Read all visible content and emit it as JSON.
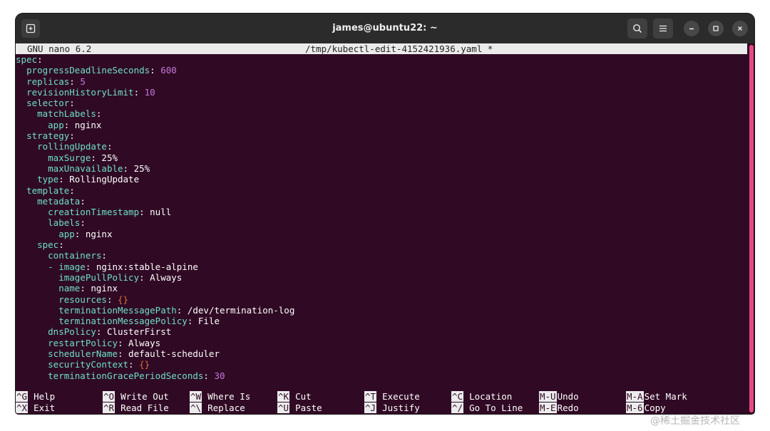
{
  "window": {
    "title": "james@ubuntu22: ~"
  },
  "nano": {
    "app": "GNU nano 6.2",
    "file": "/tmp/kubectl-edit-4152421936.yaml *"
  },
  "lines": [
    [
      [
        "k",
        "spec"
      ],
      [
        "s",
        ":"
      ]
    ],
    [
      [
        "s",
        "  "
      ],
      [
        "k",
        "progressDeadlineSeconds"
      ],
      [
        "s",
        ": "
      ],
      [
        "n",
        "600"
      ]
    ],
    [
      [
        "s",
        "  "
      ],
      [
        "k",
        "replicas"
      ],
      [
        "s",
        ": "
      ],
      [
        "n",
        "5"
      ]
    ],
    [
      [
        "s",
        "  "
      ],
      [
        "k",
        "revisionHistoryLimit"
      ],
      [
        "s",
        ": "
      ],
      [
        "n",
        "10"
      ]
    ],
    [
      [
        "s",
        "  "
      ],
      [
        "k",
        "selector"
      ],
      [
        "s",
        ":"
      ]
    ],
    [
      [
        "s",
        "    "
      ],
      [
        "k",
        "matchLabels"
      ],
      [
        "s",
        ":"
      ]
    ],
    [
      [
        "s",
        "      "
      ],
      [
        "k",
        "app"
      ],
      [
        "s",
        ": nginx"
      ]
    ],
    [
      [
        "s",
        "  "
      ],
      [
        "k",
        "strategy"
      ],
      [
        "s",
        ":"
      ]
    ],
    [
      [
        "s",
        "    "
      ],
      [
        "k",
        "rollingUpdate"
      ],
      [
        "s",
        ":"
      ]
    ],
    [
      [
        "s",
        "      "
      ],
      [
        "k",
        "maxSurge"
      ],
      [
        "s",
        ": 25%"
      ]
    ],
    [
      [
        "s",
        "      "
      ],
      [
        "k",
        "maxUnavailable"
      ],
      [
        "s",
        ": 25%"
      ]
    ],
    [
      [
        "s",
        "    "
      ],
      [
        "k",
        "type"
      ],
      [
        "s",
        ": RollingUpdate"
      ]
    ],
    [
      [
        "s",
        "  "
      ],
      [
        "k",
        "template"
      ],
      [
        "s",
        ":"
      ]
    ],
    [
      [
        "s",
        "    "
      ],
      [
        "k",
        "metadata"
      ],
      [
        "s",
        ":"
      ]
    ],
    [
      [
        "s",
        "      "
      ],
      [
        "k",
        "creationTimestamp"
      ],
      [
        "s",
        ": null"
      ]
    ],
    [
      [
        "s",
        "      "
      ],
      [
        "k",
        "labels"
      ],
      [
        "s",
        ":"
      ]
    ],
    [
      [
        "s",
        "        "
      ],
      [
        "k",
        "app"
      ],
      [
        "s",
        ": nginx"
      ]
    ],
    [
      [
        "s",
        "    "
      ],
      [
        "k",
        "spec"
      ],
      [
        "s",
        ":"
      ]
    ],
    [
      [
        "s",
        "      "
      ],
      [
        "k",
        "containers"
      ],
      [
        "s",
        ":"
      ]
    ],
    [
      [
        "s",
        "      "
      ],
      [
        "k",
        "- image"
      ],
      [
        "s",
        ": nginx:stable-alpine"
      ]
    ],
    [
      [
        "s",
        "        "
      ],
      [
        "k",
        "imagePullPolicy"
      ],
      [
        "s",
        ": Always"
      ]
    ],
    [
      [
        "s",
        "        "
      ],
      [
        "k",
        "name"
      ],
      [
        "s",
        ": nginx"
      ]
    ],
    [
      [
        "s",
        "        "
      ],
      [
        "k",
        "resources"
      ],
      [
        "s",
        ": "
      ],
      [
        "b",
        "{}"
      ]
    ],
    [
      [
        "s",
        "        "
      ],
      [
        "k",
        "terminationMessagePath"
      ],
      [
        "s",
        ": /dev/termination-log"
      ]
    ],
    [
      [
        "s",
        "        "
      ],
      [
        "k",
        "terminationMessagePolicy"
      ],
      [
        "s",
        ": File"
      ]
    ],
    [
      [
        "s",
        "      "
      ],
      [
        "k",
        "dnsPolicy"
      ],
      [
        "s",
        ": ClusterFirst"
      ]
    ],
    [
      [
        "s",
        "      "
      ],
      [
        "k",
        "restartPolicy"
      ],
      [
        "s",
        ": Always"
      ]
    ],
    [
      [
        "s",
        "      "
      ],
      [
        "k",
        "schedulerName"
      ],
      [
        "s",
        ": default-scheduler"
      ]
    ],
    [
      [
        "s",
        "      "
      ],
      [
        "k",
        "securityContext"
      ],
      [
        "s",
        ": "
      ],
      [
        "b",
        "{}"
      ]
    ],
    [
      [
        "s",
        "      "
      ],
      [
        "k",
        "terminationGracePeriodSeconds"
      ],
      [
        "s",
        ": "
      ],
      [
        "n",
        "30"
      ]
    ]
  ],
  "shortcuts": [
    {
      "key": "^G",
      "label": "Help"
    },
    {
      "key": "^O",
      "label": "Write Out"
    },
    {
      "key": "^W",
      "label": "Where Is"
    },
    {
      "key": "^K",
      "label": "Cut"
    },
    {
      "key": "^T",
      "label": "Execute"
    },
    {
      "key": "^C",
      "label": "Location"
    },
    {
      "key": "M-U",
      "label": "Undo"
    },
    {
      "key": "M-A",
      "label": "Set Mark"
    },
    {
      "key": "^X",
      "label": "Exit"
    },
    {
      "key": "^R",
      "label": "Read File"
    },
    {
      "key": "^\\",
      "label": "Replace"
    },
    {
      "key": "^U",
      "label": "Paste"
    },
    {
      "key": "^J",
      "label": "Justify"
    },
    {
      "key": "^/",
      "label": "Go To Line"
    },
    {
      "key": "M-E",
      "label": "Redo"
    },
    {
      "key": "M-6",
      "label": "Copy"
    }
  ],
  "watermark": "@稀土掘金技术社区",
  "colors": {
    "terminal_bg": "#300a24",
    "key_color": "#6ee0c8",
    "number_color": "#c678dd",
    "brace_color": "#e06c3c",
    "scrollbar": "#e64a84"
  }
}
